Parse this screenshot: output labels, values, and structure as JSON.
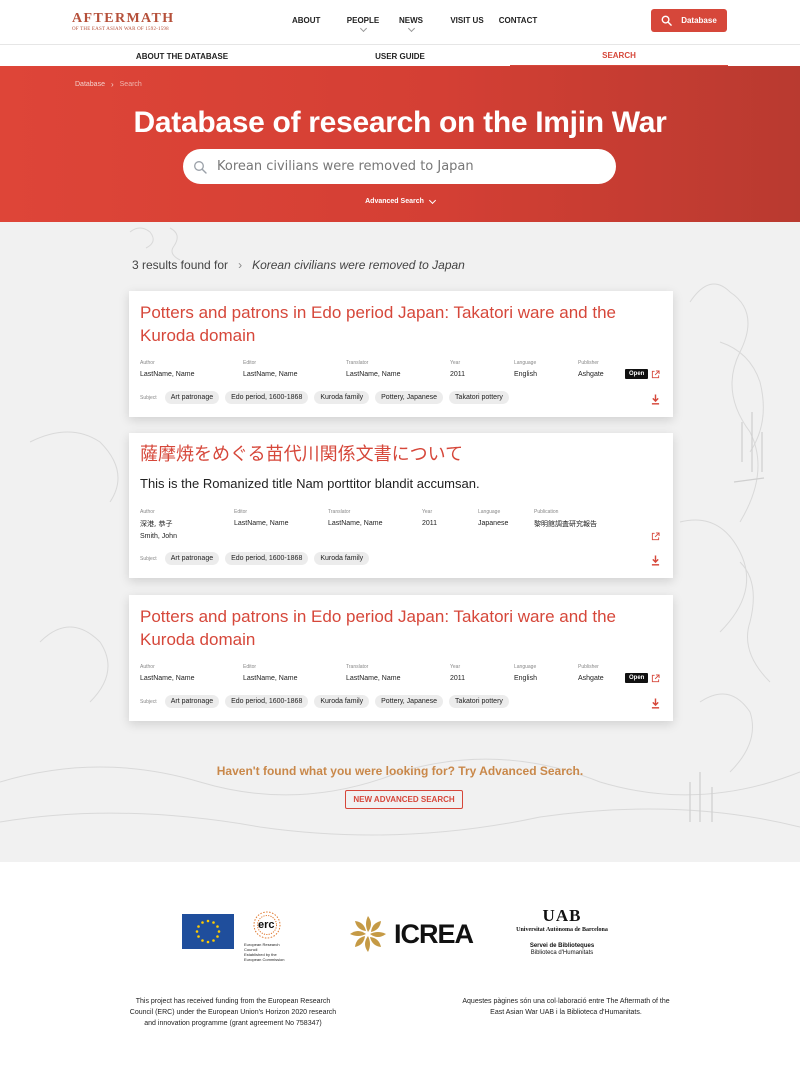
{
  "header": {
    "logo_main": "AFTERMATH",
    "logo_sub": "OF THE EAST ASIAN WAR OF 1592-1598",
    "nav": [
      "ABOUT",
      "PEOPLE",
      "NEWS",
      "VISIT US",
      "CONTACT"
    ],
    "database_button": "Database"
  },
  "subnav": {
    "items": [
      "ABOUT THE DATABASE",
      "USER GUIDE",
      "SEARCH"
    ]
  },
  "hero": {
    "breadcrumb": [
      "Database",
      "Search"
    ],
    "title": "Database of research on the Imjin War",
    "search_value": "Korean civilians were removed to Japan",
    "advanced_toggle": "Advanced Search"
  },
  "results_summary": {
    "count_text": "3 results found for",
    "query": "Korean civilians were removed to Japan"
  },
  "meta_labels": {
    "author": "Author",
    "editor": "Editor",
    "translator": "Translator",
    "year": "Year",
    "language": "Language",
    "publisher": "Publisher",
    "publication": "Publication",
    "subject": "Subject"
  },
  "results": [
    {
      "title": "Potters and patrons in Edo period Japan: Takatori ware and the Kuroda domain",
      "author": "LastName, Name",
      "editor": "LastName, Name",
      "translator": "LastName, Name",
      "year": "2011",
      "language": "English",
      "publisher": "Ashgate",
      "open_badge": "Open",
      "subjects": [
        "Art patronage",
        "Edo period, 1600-1868",
        "Kuroda family",
        "Pottery, Japanese",
        "Takatori pottery"
      ]
    },
    {
      "title": "薩摩焼をめぐる苗代川関係文書について",
      "subtitle": "This is the Romanized title Nam porttitor blandit accumsan.",
      "author_1": "深港, 恭子",
      "author_2": "Smith, John",
      "editor": "LastName, Name",
      "translator": "LastName, Name",
      "year": "2011",
      "language": "Japanese",
      "publication": "黎明館調査研究報告",
      "subjects": [
        "Art patronage",
        "Edo period, 1600-1868",
        "Kuroda family"
      ]
    },
    {
      "title": "Potters and patrons in Edo period Japan: Takatori ware and the Kuroda domain",
      "author": "LastName, Name",
      "editor": "LastName, Name",
      "translator": "LastName, Name",
      "year": "2011",
      "language": "English",
      "publisher": "Ashgate",
      "open_badge": "Open",
      "subjects": [
        "Art patronage",
        "Edo period, 1600-1868",
        "Kuroda family",
        "Pottery, Japanese",
        "Takatori pottery"
      ]
    }
  ],
  "not_found": {
    "text": "Haven't found what you were looking for? Try Advanced Search.",
    "button": "NEW ADVANCED SEARCH"
  },
  "footer": {
    "erc_word": "erc",
    "erc_caption_1": "European Research Council",
    "erc_caption_2": "Established by the European Commission",
    "icrea": "ICREA",
    "uab_logo": "UAB",
    "uab_sub": "Universitat Autònoma de Barcelona",
    "uab_line2": "Servei de Biblioteques",
    "uab_line3": "Biblioteca d'Humanitats",
    "funding_note": "This project has received funding from the European Research Council (ERC) under the European Union's Horizon 2020 research and innovation programme (grant agreement No 758347)",
    "collab_note": "Aquestes pàgines són una col·laboració entre The Aftermath of the East Asian War UAB i la Biblioteca d'Humanitats."
  },
  "colors": {
    "accent": "#d6473a",
    "gold": "#c9884a",
    "logo": "#b5503a"
  }
}
